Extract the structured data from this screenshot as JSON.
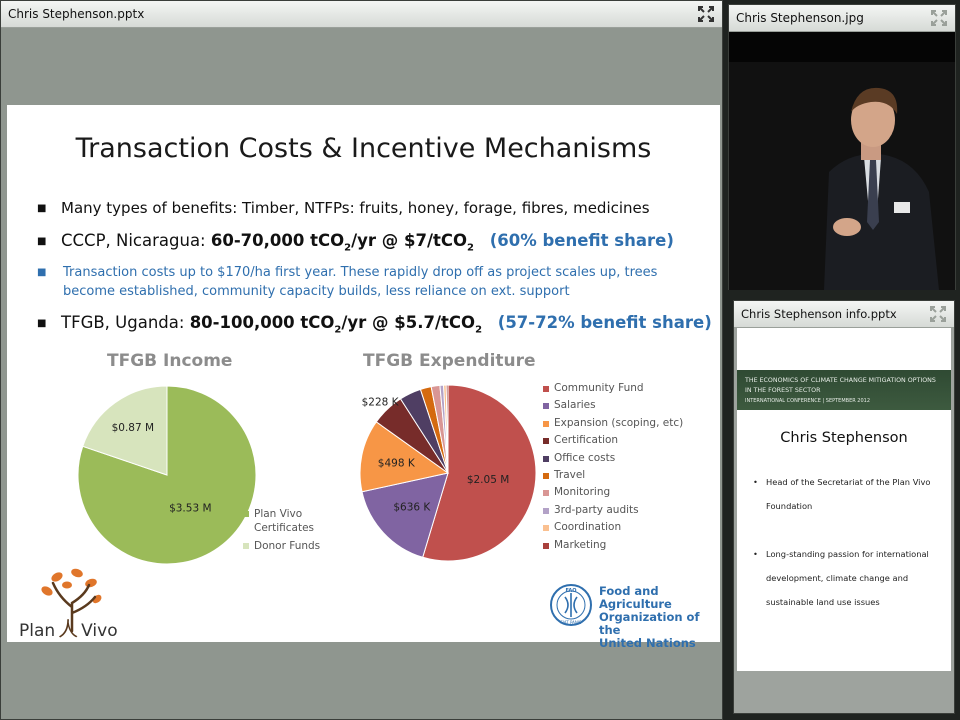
{
  "main_window": {
    "title": "Chris Stephenson.pptx",
    "slide": {
      "title": "Transaction Costs & Incentive Mechanisms",
      "bullet1": "Many types of benefits: Timber, NTFPs: fruits, honey, forage, fibres, medicines",
      "bullet2": {
        "prefix": "CCCP, Nicaragua: ",
        "bold_a": "60-70,000 tCO",
        "sub_a": "2",
        "bold_b": "/yr @ $7/tCO",
        "sub_b": "2",
        "share": "(60% benefit share)"
      },
      "bullet3": "Transaction costs up to $170/ha first year.  These rapidly drop off as project scales up, trees become established, community capacity builds, less reliance on ext. support",
      "bullet4": {
        "prefix": "TFGB, Uganda: ",
        "bold_a": "80-100,000 tCO",
        "sub_a": "2",
        "bold_b": "/yr @ $5.7/tCO",
        "sub_b": "2",
        "share": "(57-72% benefit share)"
      },
      "logo_plan": "Plan",
      "logo_vivo": "Vivo",
      "fao_line1": "Food and Agriculture",
      "fao_line2": "Organization of the",
      "fao_line3": "United Nations",
      "fao_ring": "FIAT PANIS",
      "fao_emblem_letters": "FAO"
    }
  },
  "video_window": {
    "title": "Chris Stephenson.jpg"
  },
  "info_window": {
    "title": "Chris Stephenson info.pptx",
    "banner_line1": "THE ECONOMICS OF CLIMATE CHANGE MITIGATION OPTIONS",
    "banner_line2": "IN THE FOREST SECTOR",
    "banner_line3": "INTERNATIONAL CONFERENCE | SEPTEMBER 2012",
    "name": "Chris Stephenson",
    "bullet1": "Head of the Secretariat of the Plan Vivo Foundation",
    "bullet2": "Long-standing passion for international development, climate change and sustainable land use issues"
  },
  "colors": {
    "accent_blue": "#2f6fae",
    "income_green": "#9bbb59",
    "income_light": "#d7e4bd"
  },
  "chart_data": [
    {
      "type": "pie",
      "title": "TFGB Income",
      "categories": [
        "Plan Vivo Certificates",
        "Donor Funds"
      ],
      "values": [
        3.53,
        0.87
      ],
      "labels": [
        "$3.53 M",
        "$0.87 M"
      ],
      "colors": [
        "#9bbb59",
        "#d7e4bd"
      ],
      "legend": "right"
    },
    {
      "type": "pie",
      "title": "TFGB Expenditure",
      "categories": [
        "Community Fund",
        "Salaries",
        "Expansion (scoping, etc)",
        "Certification",
        "Office costs",
        "Travel",
        "Monitoring",
        "3rd-party audits",
        "Coordination",
        "Marketing"
      ],
      "values": [
        2050,
        636,
        498,
        228,
        150,
        75,
        60,
        25,
        18,
        12
      ],
      "labels": [
        "$2.05 M",
        "$636 K",
        "$498 K",
        "$228 K",
        "",
        "",
        "",
        "",
        "",
        ""
      ],
      "colors": [
        "#c0504d",
        "#8064a2",
        "#f79646",
        "#772c2a",
        "#4f3e63",
        "#d46a0f",
        "#d99694",
        "#b3a2c7",
        "#fac090",
        "#a9403c"
      ],
      "legend": "right"
    }
  ]
}
